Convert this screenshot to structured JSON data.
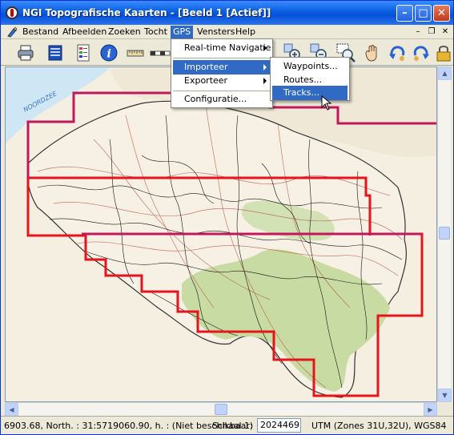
{
  "window": {
    "title": "NGI Topografische Kaarten - [Beeld 1 [Actief]]",
    "controls": {
      "minimize_icon": "minimize-icon",
      "maximize_icon": "maximize-icon",
      "close_icon": "close-icon"
    }
  },
  "menubar": {
    "items": [
      {
        "label": "Bestand"
      },
      {
        "label": "Afbeelden"
      },
      {
        "label": "Zoeken"
      },
      {
        "label": "Tocht"
      },
      {
        "label": "GPS"
      },
      {
        "label": "Vensters"
      },
      {
        "label": "Help"
      }
    ],
    "active": "GPS"
  },
  "toolbar": {
    "buttons": [
      "print-icon",
      "layers-icon",
      "legend-icon",
      "info-icon",
      "ruler-icon",
      "zoom-in-icon",
      "zoom-out-icon",
      "zoom-window-icon",
      "pan-hand-icon",
      "undo-icon",
      "redo-icon",
      "lock-icon"
    ]
  },
  "gps_menu": {
    "items": [
      {
        "label": "Real-time Navigatie",
        "submenu": true
      },
      {
        "label": "Importeer",
        "submenu": true,
        "highlighted": true
      },
      {
        "label": "Exporteer",
        "submenu": true
      },
      {
        "label": "Configuratie..."
      }
    ]
  },
  "import_submenu": {
    "items": [
      {
        "label": "Waypoints..."
      },
      {
        "label": "Routes..."
      },
      {
        "label": "Tracks...",
        "highlighted": true
      }
    ]
  },
  "map": {
    "sea_label": "NOORDZEE",
    "colors": {
      "sea": "#cfe6f5",
      "land": "#f4efe0",
      "forest": "#c8dba3",
      "sheet_red": "#e8141c",
      "sheet_magenta": "#c2185b"
    }
  },
  "statusbar": {
    "coords": "6903.68, North. : 31:5719060.90, h. : (Niet beschikbaar)",
    "scale_label": "Schaal 1:",
    "scale_value": "2024469",
    "projection": "UTM (Zones 31U,32U), WGS84"
  }
}
